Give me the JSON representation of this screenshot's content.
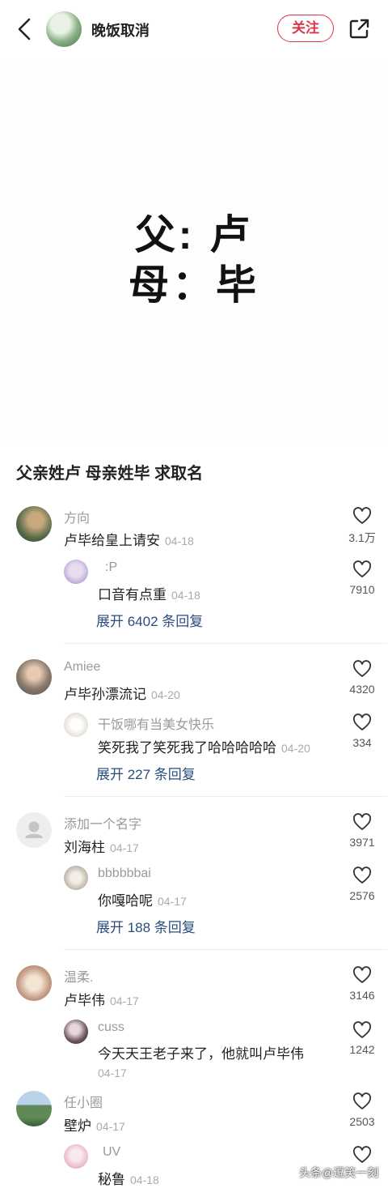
{
  "header": {
    "author": "晚饭取消",
    "follow_label": "关注"
  },
  "hero": {
    "line1": "父: 卢",
    "line2": "母：毕"
  },
  "post": {
    "title": "父亲姓卢 母亲姓毕 求取名"
  },
  "comments": [
    {
      "user": "方向",
      "text": "卢毕给皇上请安",
      "date": "04-18",
      "likes": "3.1万",
      "reply": {
        "user": ":P",
        "text": "口音有点重",
        "date": "04-18",
        "likes": "7910"
      },
      "expand": "展开 6402 条回复"
    },
    {
      "user": "Amiee",
      "text": "卢毕孙漂流记",
      "date": "04-20",
      "likes": "4320",
      "reply": {
        "user": "干饭哪有当美女快乐",
        "text": "笑死我了笑死我了哈哈哈哈哈",
        "date": "04-20",
        "likes": "334"
      },
      "expand": "展开 227 条回复"
    },
    {
      "user": "添加一个名字",
      "text": "刘海柱",
      "date": "04-17",
      "likes": "3971",
      "reply": {
        "user": "bbbbbbai",
        "text": "你嘎哈呢",
        "date": "04-17",
        "likes": "2576"
      },
      "expand": "展开 188 条回复"
    },
    {
      "user": "温柔.",
      "text": "卢毕伟",
      "date": "04-17",
      "likes": "3146",
      "reply": {
        "user": "cuss",
        "text": "今天天王老子来了，他就叫卢毕伟",
        "date": "04-17",
        "likes": "1242"
      }
    },
    {
      "user": "任小圈",
      "text": "壁炉",
      "date": "04-17",
      "likes": "2503",
      "reply": {
        "user": "UV",
        "text": "秘鲁",
        "date": "04-18",
        "likes": ""
      }
    }
  ],
  "watermark": "头条@逗笑一刻",
  "colors": {
    "accent_red": "#d9364b",
    "link_blue": "#2a4d7d"
  },
  "icons": [
    "back-icon",
    "share-icon",
    "heart-icon",
    "default-avatar-icon"
  ]
}
